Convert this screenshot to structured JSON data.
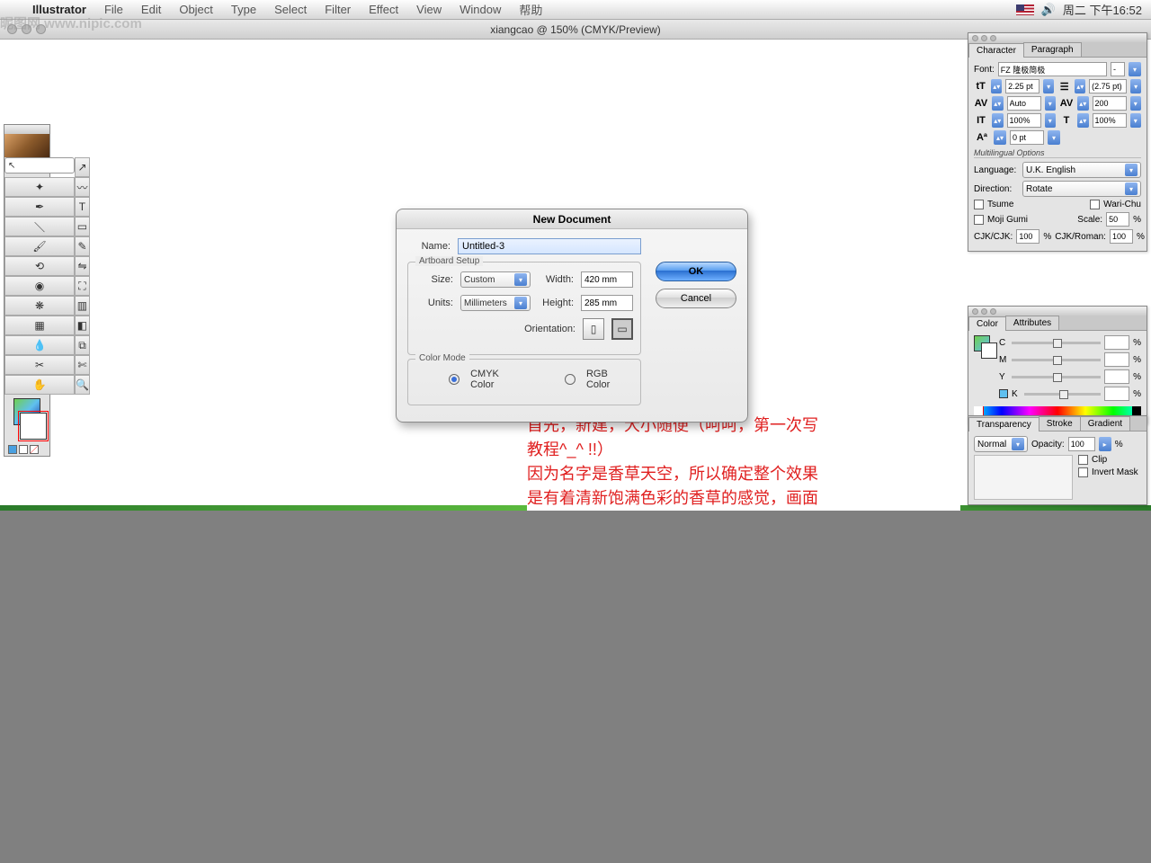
{
  "menubar": {
    "app": "Illustrator",
    "items": [
      "File",
      "Edit",
      "Object",
      "Type",
      "Select",
      "Filter",
      "Effect",
      "View",
      "Window",
      "帮助"
    ],
    "clock": "周二 下午16:52"
  },
  "watermark": "昵图网 www.nipic.com",
  "doctitle": "xiangcao @ 150% (CMYK/Preview)",
  "dialog": {
    "title": "New Document",
    "name_label": "Name:",
    "name_value": "Untitled-3",
    "artboard_legend": "Artboard Setup",
    "size_label": "Size:",
    "size_value": "Custom",
    "units_label": "Units:",
    "units_value": "Millimeters",
    "width_label": "Width:",
    "width_value": "420 mm",
    "height_label": "Height:",
    "height_value": "285 mm",
    "orient_label": "Orientation:",
    "colormode_legend": "Color Mode",
    "cmyk": "CMYK Color",
    "rgb": "RGB Color",
    "ok": "OK",
    "cancel": "Cancel"
  },
  "tutorial": {
    "l1": "首先，新建，大小随便（呵呵，第一次写",
    "l2": "教程^_^ !!）",
    "l3": "因为名字是香草天空，所以确定整个效果",
    "l4": "是有着清新饱满色彩的香草的感觉，画面"
  },
  "char_panel": {
    "tab1": "Character",
    "tab2": "Paragraph",
    "font_label": "Font:",
    "font_value": "FZ 隆极简极",
    "style": "-",
    "size": "2.25 pt",
    "leading": "(2.75 pt)",
    "kern": "Auto",
    "track": "200",
    "hscale": "100%",
    "vscale": "100%",
    "baseline": "0 pt",
    "multi": "Multilingual Options",
    "lang_label": "Language:",
    "lang": "U.K. English",
    "dir_label": "Direction:",
    "dir": "Rotate",
    "tsume": "Tsume",
    "wari": "Wari-Chu",
    "moji": "Moji Gumi",
    "scale_l": "Scale:",
    "scale": "50",
    "cjkcjk": "CJK/CJK:",
    "cjkcjk_v": "100",
    "cjkrom": "CJK/Roman:",
    "cjkrom_v": "100",
    "pct": "%"
  },
  "color_panel": {
    "tab1": "Color",
    "tab2": "Attributes",
    "c": "C",
    "m": "M",
    "y": "Y",
    "k": "K",
    "pct": "%"
  },
  "trans_panel": {
    "tab1": "Transparency",
    "tab2": "Stroke",
    "tab3": "Gradient",
    "mode": "Normal",
    "op_label": "Opacity:",
    "op": "100",
    "clip": "Clip",
    "invert": "Invert Mask"
  }
}
